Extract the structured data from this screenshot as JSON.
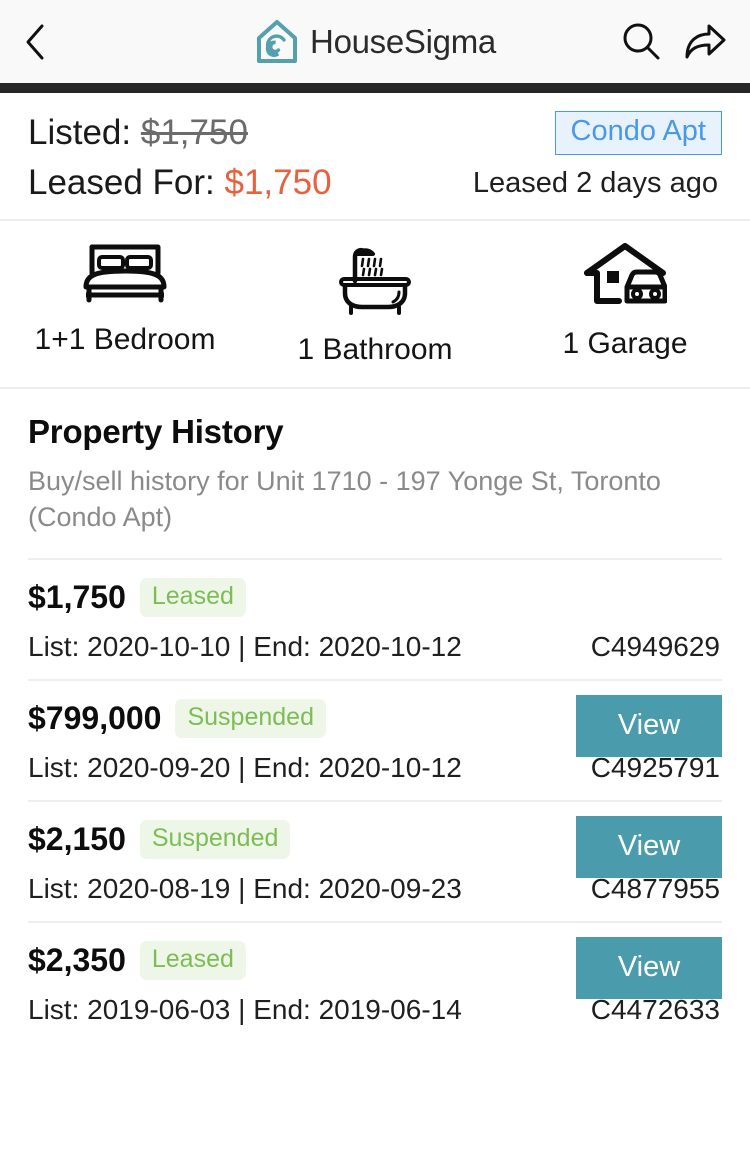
{
  "navbar": {
    "back_icon": "chevron-left-icon",
    "brand_logo_icon": "housesigma-house-spiral-logo",
    "brand_name": "HouseSigma",
    "search_icon": "search-icon",
    "share_icon": "share-arrow-icon"
  },
  "price": {
    "listed_label": "Listed: ",
    "listed_value": "$1,750",
    "leased_label": "Leased For: ",
    "leased_value": "$1,750",
    "property_type": "Condo Apt",
    "leased_ago": "Leased 2 days ago",
    "accent_color": "#e8603c",
    "badge_color": "#4a98e8"
  },
  "amenities": [
    {
      "icon": "bed-icon",
      "label": "1+1 Bedroom"
    },
    {
      "icon": "bathtub-shower-icon",
      "label": "1 Bathroom"
    },
    {
      "icon": "house-garage-car-icon",
      "label": "1 Garage"
    }
  ],
  "history": {
    "title": "Property History",
    "subtitle": "Buy/sell history for Unit 1710 - 197 Yonge St, Toronto (Condo Apt)",
    "view_label": "View",
    "view_button_color": "#4a9cac",
    "status_color": "#7cbd55",
    "rows": [
      {
        "price": "$1,750",
        "status": "Leased",
        "dates": "List: 2020-10-10 | End: 2020-10-12",
        "mls": "C4949629",
        "has_view": false
      },
      {
        "price": "$799,000",
        "status": "Suspended",
        "dates": "List: 2020-09-20 | End: 2020-10-12",
        "mls": "C4925791",
        "has_view": true
      },
      {
        "price": "$2,150",
        "status": "Suspended",
        "dates": "List: 2020-08-19 | End: 2020-09-23",
        "mls": "C4877955",
        "has_view": true
      },
      {
        "price": "$2,350",
        "status": "Leased",
        "dates": "List: 2019-06-03 | End: 2019-06-14",
        "mls": "C4472633",
        "has_view": true
      }
    ]
  }
}
